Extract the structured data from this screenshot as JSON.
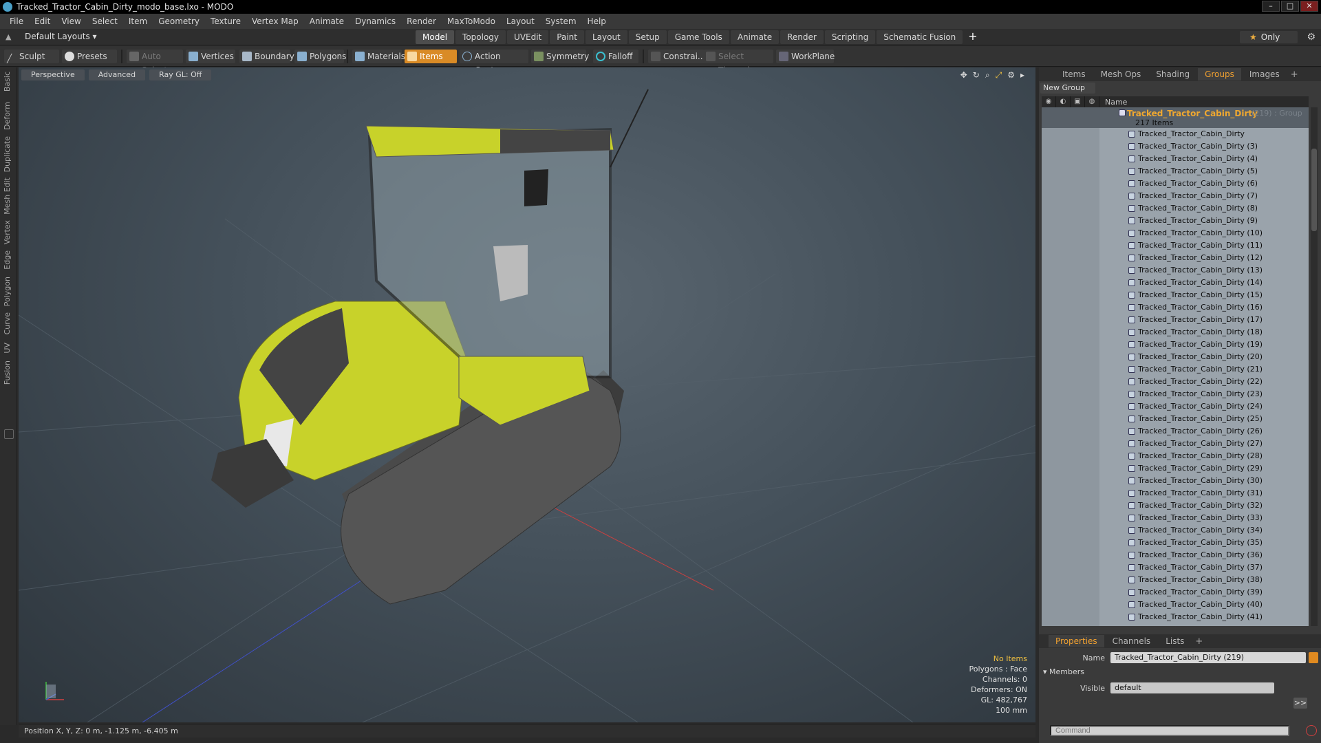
{
  "window": {
    "title": "Tracked_Tractor_Cabin_Dirty_modo_base.lxo - MODO",
    "controls": [
      "–",
      "□",
      "✕"
    ]
  },
  "menu": [
    "File",
    "Edit",
    "View",
    "Select",
    "Item",
    "Geometry",
    "Texture",
    "Vertex Map",
    "Animate",
    "Dynamics",
    "Render",
    "MaxToModo",
    "Layout",
    "System",
    "Help"
  ],
  "layout": {
    "selector": "Default Layouts ▾",
    "tabs": [
      "Model",
      "Topology",
      "UVEdit",
      "Paint",
      "Layout",
      "Setup",
      "Game Tools",
      "Animate",
      "Render",
      "Scripting",
      "Schematic Fusion"
    ],
    "active_tab": "Model",
    "plus": "+",
    "only_label": "Only"
  },
  "toolbar": {
    "sculpt": "Sculpt",
    "presets": "Presets",
    "auto_select": "Auto Select",
    "vertices": "Vertices",
    "boundary": "Boundary",
    "polygons": "Polygons",
    "materials": "Materials",
    "items": "Items",
    "action_center": "Action Center",
    "symmetry": "Symmetry",
    "falloff": "Falloff",
    "constraints": "Constrai...",
    "select_through": "Select Through",
    "workplane": "WorkPlane"
  },
  "left_tabs": [
    "Basic",
    "Deform",
    "Duplicate",
    "Mesh Edit",
    "Vertex",
    "Edge",
    "Polygon",
    "Curve",
    "UV",
    "Fusion"
  ],
  "viewport": {
    "view_mode": "Perspective",
    "shading": "Advanced",
    "raygl": "Ray GL: Off",
    "stats": {
      "selection": "No Items",
      "polygons": "Polygons : Face",
      "channels": "Channels: 0",
      "deformers": "Deformers: ON",
      "gl": "GL: 482,767",
      "scale": "100 mm"
    },
    "colors": {
      "body": "#c8d22a",
      "track": "#3a3a3a",
      "bg_center": "#5a6670"
    }
  },
  "status": {
    "position": "Position X, Y, Z:  0 m, -1.125 m, -6.405 m"
  },
  "right_panel": {
    "tabs": [
      "Items",
      "Mesh Ops",
      "Shading",
      "Groups",
      "Images"
    ],
    "active_tab": "Groups",
    "plus": "+",
    "new_group": "New Group",
    "column_name": "Name",
    "group": {
      "name": "Tracked_Tractor_Cabin_Dirty",
      "count": "(219) : Group",
      "items_label": "217 Items"
    },
    "items": [
      "Tracked_Tractor_Cabin_Dirty",
      "Tracked_Tractor_Cabin_Dirty (3)",
      "Tracked_Tractor_Cabin_Dirty (4)",
      "Tracked_Tractor_Cabin_Dirty (5)",
      "Tracked_Tractor_Cabin_Dirty (6)",
      "Tracked_Tractor_Cabin_Dirty (7)",
      "Tracked_Tractor_Cabin_Dirty (8)",
      "Tracked_Tractor_Cabin_Dirty (9)",
      "Tracked_Tractor_Cabin_Dirty (10)",
      "Tracked_Tractor_Cabin_Dirty (11)",
      "Tracked_Tractor_Cabin_Dirty (12)",
      "Tracked_Tractor_Cabin_Dirty (13)",
      "Tracked_Tractor_Cabin_Dirty (14)",
      "Tracked_Tractor_Cabin_Dirty (15)",
      "Tracked_Tractor_Cabin_Dirty (16)",
      "Tracked_Tractor_Cabin_Dirty (17)",
      "Tracked_Tractor_Cabin_Dirty (18)",
      "Tracked_Tractor_Cabin_Dirty (19)",
      "Tracked_Tractor_Cabin_Dirty (20)",
      "Tracked_Tractor_Cabin_Dirty (21)",
      "Tracked_Tractor_Cabin_Dirty (22)",
      "Tracked_Tractor_Cabin_Dirty (23)",
      "Tracked_Tractor_Cabin_Dirty (24)",
      "Tracked_Tractor_Cabin_Dirty (25)",
      "Tracked_Tractor_Cabin_Dirty (26)",
      "Tracked_Tractor_Cabin_Dirty (27)",
      "Tracked_Tractor_Cabin_Dirty (28)",
      "Tracked_Tractor_Cabin_Dirty (29)",
      "Tracked_Tractor_Cabin_Dirty (30)",
      "Tracked_Tractor_Cabin_Dirty (31)",
      "Tracked_Tractor_Cabin_Dirty (32)",
      "Tracked_Tractor_Cabin_Dirty (33)",
      "Tracked_Tractor_Cabin_Dirty (34)",
      "Tracked_Tractor_Cabin_Dirty (35)",
      "Tracked_Tractor_Cabin_Dirty (36)",
      "Tracked_Tractor_Cabin_Dirty (37)",
      "Tracked_Tractor_Cabin_Dirty (38)",
      "Tracked_Tractor_Cabin_Dirty (39)",
      "Tracked_Tractor_Cabin_Dirty (40)",
      "Tracked_Tractor_Cabin_Dirty (41)"
    ]
  },
  "properties": {
    "tabs": [
      "Properties",
      "Channels",
      "Lists"
    ],
    "active_tab": "Properties",
    "plus": "+",
    "name_label": "Name",
    "name_value": "Tracked_Tractor_Cabin_Dirty (219)",
    "members_label": "Members",
    "visible_label": "Visible",
    "visible_value": "default",
    "more": ">>",
    "command_placeholder": "Command"
  }
}
